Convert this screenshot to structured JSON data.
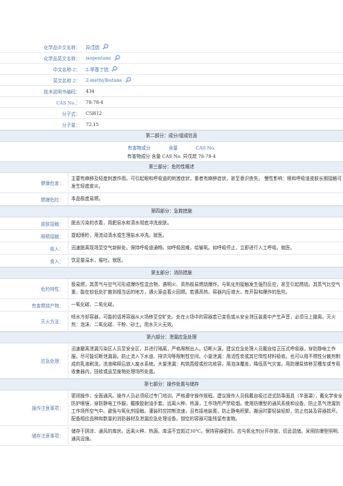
{
  "basic": [
    {
      "label": "化学品中文名称：",
      "value": "异戊烷",
      "icon": "search-icon",
      "link": true
    },
    {
      "label": "化学品英文名称：",
      "value": "isopentane",
      "icon": "search-icon",
      "link": true
    },
    {
      "label": "中文名称 2：",
      "value": "2-甲基丁烷",
      "icon": "search-icon",
      "link": true
    },
    {
      "label": "英文名称 2：",
      "value": "2-methylbutane",
      "icon": "search-icon",
      "link": true
    },
    {
      "label": "技术说明书编码：",
      "value": "434",
      "link": false
    },
    {
      "label": "CAS No.：",
      "value": "78-78-4",
      "link": false
    },
    {
      "label": "分子式：",
      "value": "C5H12",
      "link": false
    },
    {
      "label": "分子量：",
      "value": "72.15",
      "link": false
    }
  ],
  "part2": {
    "title": "第二部分：成分/组成信息",
    "headers": [
      "有害物成分",
      "含量",
      "CAS No."
    ],
    "row": "有害物成分  含量  CAS No. 异戊烷  78-78-4"
  },
  "part3": {
    "title": "第三部分：危险性概述",
    "rows": [
      {
        "k": "健康危害：",
        "v": "主要有麻醉及轻度刺激作用。可引起眼和呼吸道的刺激症状，重者有麻醉症状，甚至意识丧失。 慢性影响：眼和呼吸道皮肤长期接触可发生轻度皮炎。"
      },
      {
        "k": "燃爆危险：",
        "v": "本品极度易燃。"
      }
    ]
  },
  "part4": {
    "title": "第四部分：急救措施",
    "rows": [
      {
        "k": "皮肤接触：",
        "v": "脱去污染的衣着，用肥皂水和清水彻底冲洗皮肤。"
      },
      {
        "k": "眼睛接触：",
        "v": "提起眼睑，用流动清水或生理盐水冲洗。就医。"
      },
      {
        "k": "吸入：",
        "v": "迅速脱离现场至空气新鲜处。保持呼吸道通畅。如呼吸困难，给输氧。如呼吸停止，立即进行人工呼吸。就医。"
      },
      {
        "k": "食入：",
        "v": "饮足量温水，催吐。就医。"
      }
    ]
  },
  "part5": {
    "title": "第五部分：消防措施",
    "rows": [
      {
        "k": "危险特性：",
        "v": "极易燃，其蒸气与空气可形成爆炸性混合物，遇明火、高热极易燃烧爆炸。与氧化剂接触发生强烈反应，甚至引起燃烧。其蒸气比空气重，能在较低处扩散到相当远的地方，遇火源会着火回燃。若遇高热，容器内压增大，有开裂和爆炸的危险。"
      },
      {
        "k": "有害燃烧产物：",
        "v": "一氧化碳、二氧化碳。"
      },
      {
        "k": "灭火方法：",
        "v": "喷水冷却容器，可能的话将容器从火场移至空旷处。处在火场中的容器若已变色或从安全泄压装置中产生声音，必须马上撤离。灭火剂：泡沫、二氧化碳、干粉、砂土。用水灭火无效。"
      }
    ]
  },
  "part6": {
    "title": "第六部分：泄漏应急处理",
    "rows": [
      {
        "k": "应急处理：",
        "v": "迅速撤离泄漏污染区人员至安全区，并进行隔离，严格限制出入。切断火源。建议应急处理人员戴自给正压式呼吸器，穿防静电工作服。尽可能切断泄漏源。防止流入下水道、排洪沟等限制性空间。小量泄漏：用活性炭或其它惰性材料吸收。也可以用不燃性分散剂制成的乳液刷洗，洗液稀释后放入废水系统。大量泄漏：构筑围堤或挖坑收容。用泡沫覆盖，降低蒸气灾害。用防爆泵转移至槽车或专用收集器内，回收或运至废物处理场所处置。"
      }
    ]
  },
  "part7": {
    "title": "第七部分：操作处置与储存",
    "rows": [
      {
        "k": "操作注意事项：",
        "v": "密闭操作，全面通风。操作人员必须经过专门培训，严格遵守操作规程。建议操作人员佩戴自吸过滤式防毒面具（半面罩），戴化学安全防护眼镜，穿防静电工作服，戴橡胶耐油手套。远离火种、热源，工作场所严禁吸烟。使用防爆型的通风系统和设备。防止蒸气泄漏到工作场所空气中。避免与氧化剂接触。灌装时应控制流速，且有接地装置，防止静电积聚。搬运时要轻装轻卸，防止包装及容器损坏。配备相应品种和数量的消防器材及泄漏应急处理设备。倒空的容器可能残留有害物。"
      },
      {
        "k": "储存注意事项：",
        "v": "储存于阴凉、通风的库房。远离火种、热源。库温不宜超过30℃。保持容器密封。应与氧化剂分开存放，切忌混储。采用防爆型照明、通风设施。"
      }
    ]
  },
  "colors": {
    "label": "#5a78a8",
    "link": "#3c6fb6",
    "section_bg": "#e8eef5"
  }
}
